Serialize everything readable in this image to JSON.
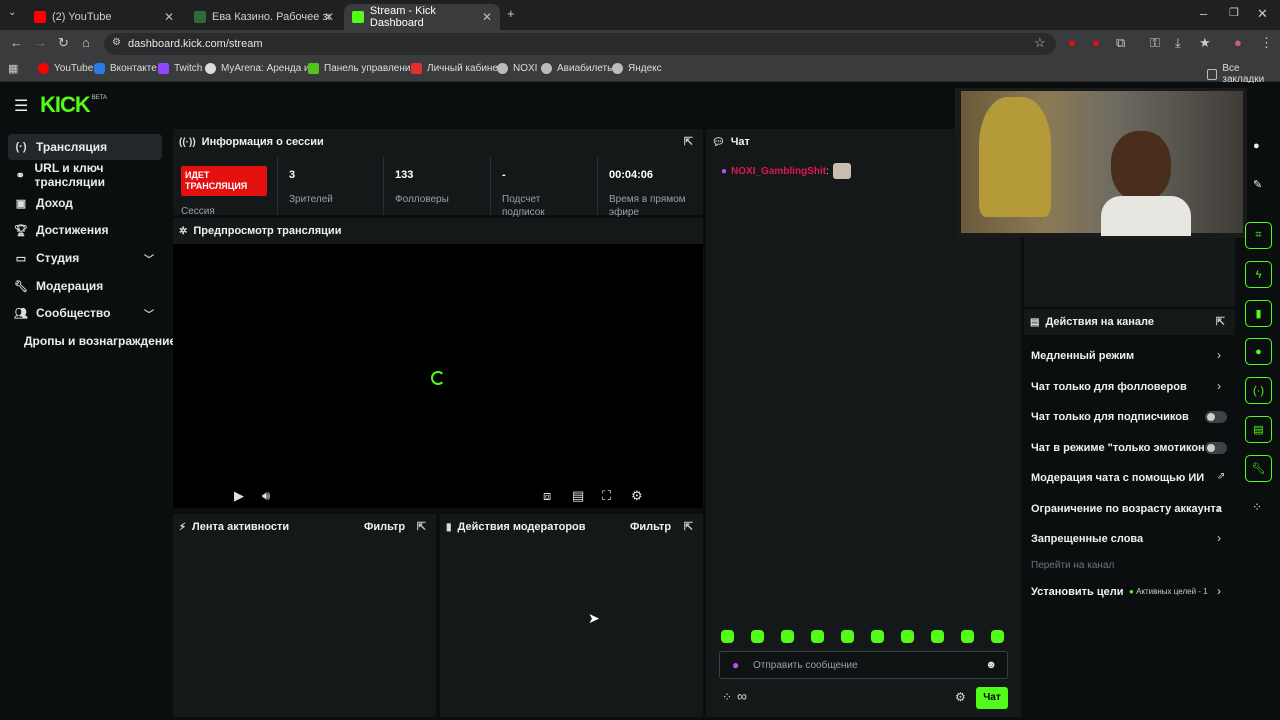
{
  "browser": {
    "tabs": [
      {
        "label": "(2) YouTube",
        "color": "#ff0000"
      },
      {
        "label": "Ева Казино. Рабочее зеркало",
        "color": "#2f6b3a"
      },
      {
        "label": "Stream - Kick Dashboard",
        "color": "#53fc18"
      }
    ],
    "url": "dashboard.kick.com/stream",
    "bookmarks": [
      {
        "label": "YouTube",
        "color": "#ff0000"
      },
      {
        "label": "Вконтакте",
        "color": "#2d7be6"
      },
      {
        "label": "Twitch",
        "color": "#9146ff"
      },
      {
        "label": "MyArena: Аренда и...",
        "color": "#dddddd"
      },
      {
        "label": "Панель управлени...",
        "color": "#52c41a"
      },
      {
        "label": "Личный кабинет",
        "color": "#e03030"
      },
      {
        "label": "NOXI",
        "color": "#bbbbbb"
      },
      {
        "label": "Авиабилеты",
        "color": "#bbbbbb"
      },
      {
        "label": "Яндекс",
        "color": "#bbbbbb"
      }
    ],
    "all_bookmarks": "Все закладки"
  },
  "logo": {
    "text": "KICK",
    "badge": "BETA"
  },
  "sidebar": {
    "items": [
      {
        "label": "Трансляция",
        "icon": "broadcast-icon"
      },
      {
        "label": "URL и ключ трансляции",
        "icon": "link-icon"
      },
      {
        "label": "Доход",
        "icon": "revenue-icon"
      },
      {
        "label": "Достижения",
        "icon": "trophy-icon"
      },
      {
        "label": "Студия",
        "icon": "studio-icon"
      },
      {
        "label": "Модерация",
        "icon": "wrench-icon"
      },
      {
        "label": "Сообщество",
        "icon": "community-icon"
      },
      {
        "label": "Дропы и вознаграждение",
        "icon": ""
      }
    ]
  },
  "session": {
    "title": "Информация о сессии",
    "live_badge": "ИДЕТ ТРАНСЛЯЦИЯ",
    "live_sub": "Сессия",
    "stats": [
      {
        "value": "3",
        "label": "Зрителей"
      },
      {
        "value": "133",
        "label": "Фолловеры"
      },
      {
        "value": "-",
        "label": "Подсчет подписок"
      },
      {
        "value": "00:04:06",
        "label": "Время в прямом эфире"
      }
    ]
  },
  "preview": {
    "title": "Предпросмотр трансляции"
  },
  "activity": {
    "title": "Лента активности",
    "filter": "Фильтр"
  },
  "modactions": {
    "title": "Действия модераторов",
    "filter": "Фильтр"
  },
  "chat": {
    "title": "Чат",
    "message_user": "NOXI_GamblingShit",
    "placeholder": "Отправить сообщение",
    "send_label": "Чат",
    "emote_count": 10
  },
  "channel_actions": {
    "title": "Действия на канале",
    "items": [
      {
        "label": "Медленный режим",
        "control": "arrow"
      },
      {
        "label": "Чат только для фолловеров",
        "control": "arrow"
      },
      {
        "label": "Чат только для подписчиков",
        "control": "toggle"
      },
      {
        "label": "Чат в режиме \"только эмотиконы\"",
        "control": "toggle"
      },
      {
        "label": "Модерация чата с помощью ИИ",
        "control": "external"
      },
      {
        "label": "Ограничение по возрасту аккаунта",
        "control": "arrow"
      },
      {
        "label": "Запрещенные слова",
        "control": "arrow"
      }
    ],
    "goto_channel": "Перейти на канал",
    "goals_label": "Установить цели",
    "goals_status": "Активных целей - 1"
  },
  "colors": {
    "accent": "#53fc18",
    "live": "#e31010",
    "bg": "#0b0e0f",
    "panel": "#141819"
  }
}
